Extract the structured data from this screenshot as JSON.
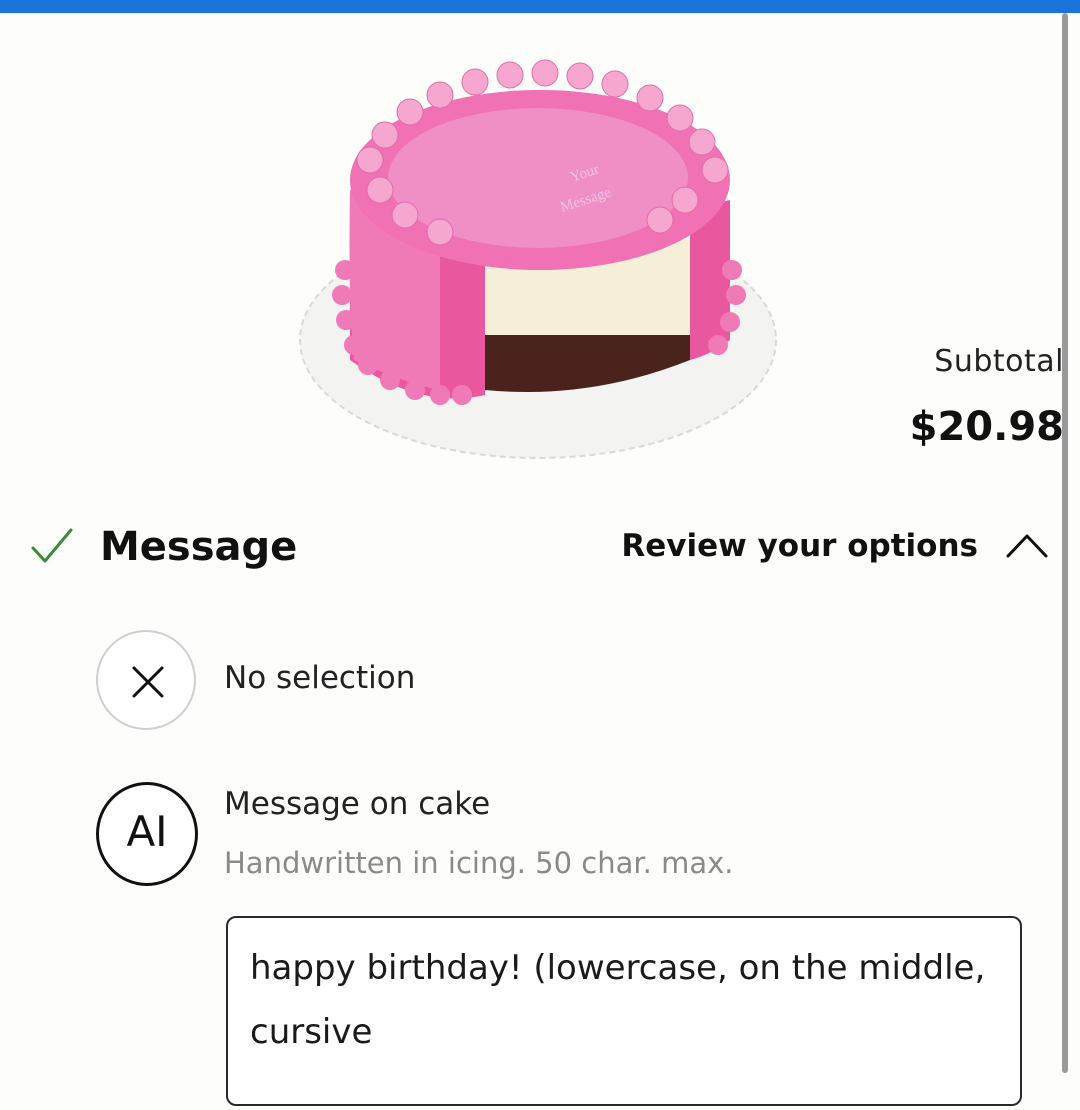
{
  "product": {
    "image_alt": "Pink frosted cake with cut slice showing vanilla and chocolate layers",
    "cake_top_text": "Your Message",
    "subtotal_label": "Subtotal",
    "subtotal_value": "$20.98"
  },
  "section": {
    "title": "Message",
    "review_label": "Review your options",
    "completed": true
  },
  "options": {
    "none": {
      "label": "No selection",
      "icon": "close-icon"
    },
    "message": {
      "icon_text": "AI",
      "title": "Message on cake",
      "subtitle": "Handwritten in icing. 50 char. max.",
      "value": "happy birthday! (lowercase, on the middle, cursive"
    }
  },
  "colors": {
    "accent_bar": "#1a73d8",
    "check": "#3a8a3a",
    "cake_pink": "#e86aa8"
  }
}
